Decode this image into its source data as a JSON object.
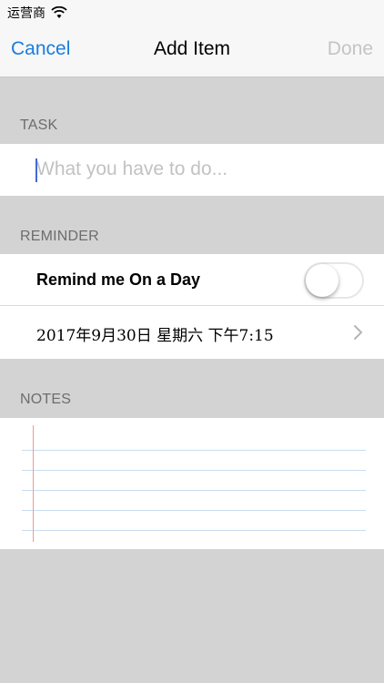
{
  "status_bar": {
    "carrier": "运营商"
  },
  "nav": {
    "cancel_label": "Cancel",
    "title": "Add Item",
    "done_label": "Done"
  },
  "task": {
    "header": "TASK",
    "placeholder": "What you have to do...",
    "value": ""
  },
  "reminder": {
    "header": "REMINDER",
    "toggle_label": "Remind me On a Day",
    "toggle_on": false,
    "date_text": "2017年9月30日 星期六 下午7:15"
  },
  "notes": {
    "header": "NOTES",
    "value": ""
  },
  "colors": {
    "accent": "#1a7de0",
    "disabled": "#c4c4c4",
    "background": "#d3d3d3",
    "caret": "#3f6ad8",
    "notes_rule": "#c9ddf0",
    "notes_margin": "#ef9b8a"
  }
}
